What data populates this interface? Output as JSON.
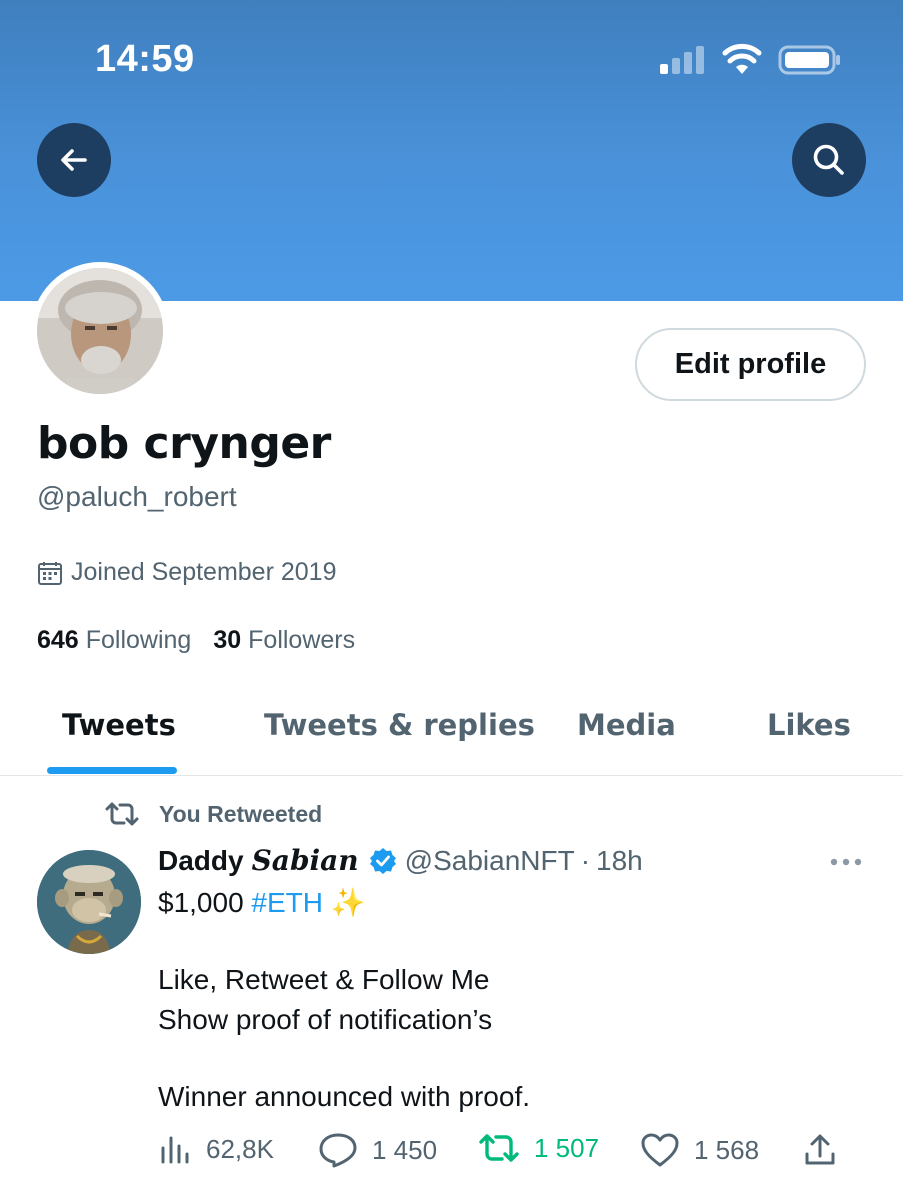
{
  "status_bar": {
    "time": "14:59"
  },
  "header": {
    "back_icon": "arrow-left-icon",
    "search_icon": "search-icon",
    "banner_color": "#4a92da"
  },
  "profile": {
    "name": "bob crynger",
    "handle": "@paluch_robert",
    "edit_button": "Edit profile",
    "joined": "Joined September 2019",
    "following_count": "646",
    "following_label": "Following",
    "followers_count": "30",
    "followers_label": "Followers"
  },
  "tabs": [
    {
      "label": "Tweets",
      "active": true
    },
    {
      "label": "Tweets & replies",
      "active": false
    },
    {
      "label": "Media",
      "active": false
    },
    {
      "label": "Likes",
      "active": false
    }
  ],
  "tweet": {
    "retweet_context": "You Retweeted",
    "author_name": "Daddy",
    "author_name_styled": "Sabian",
    "verified": true,
    "author_handle": "@SabianNFT",
    "separator": "·",
    "time": "18h",
    "line1_prefix": "$1,000 ",
    "line1_hashtag": "#ETH",
    "line1_emoji": "✨",
    "line2": "Like, Retweet & Follow Me",
    "line3": "Show proof of notification’s",
    "line4": "Winner announced with proof.",
    "views": "62,8K",
    "replies": "1 450",
    "retweets": "1 507",
    "likes": "1 568"
  },
  "colors": {
    "accent": "#1d9bf0",
    "retweet_green": "#00ba7c",
    "secondary_text": "#536471",
    "dark_button": "#1d3e60"
  }
}
